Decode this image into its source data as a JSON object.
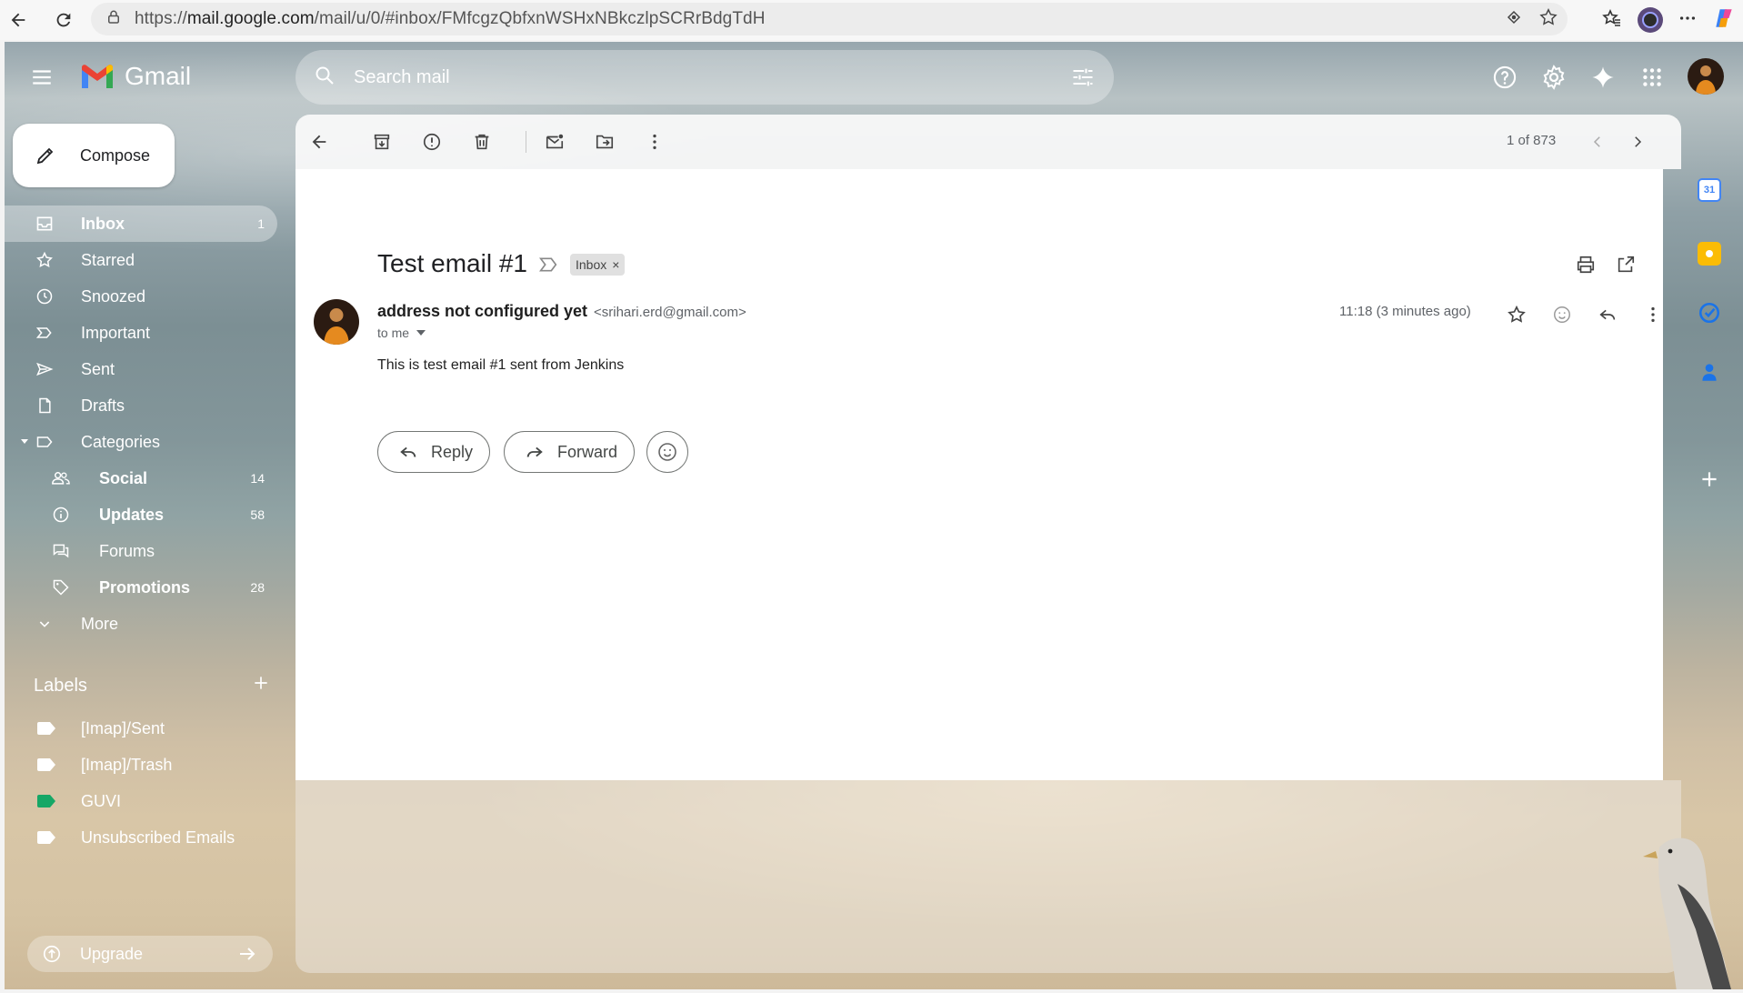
{
  "browser": {
    "url_prefix": "https://",
    "url_host": "mail.google.com",
    "url_path": "/mail/u/0/#inbox/FMfcgzQbfxnWSHxNBkczlpSCRrBdgTdH"
  },
  "app": {
    "name": "Gmail"
  },
  "search": {
    "placeholder": "Search mail"
  },
  "sidebar": {
    "compose_label": "Compose",
    "items": [
      {
        "label": "Inbox",
        "count": "1"
      },
      {
        "label": "Starred",
        "count": ""
      },
      {
        "label": "Snoozed",
        "count": ""
      },
      {
        "label": "Important",
        "count": ""
      },
      {
        "label": "Sent",
        "count": ""
      },
      {
        "label": "Drafts",
        "count": ""
      },
      {
        "label": "Categories",
        "count": ""
      }
    ],
    "categories": [
      {
        "label": "Social",
        "count": "14"
      },
      {
        "label": "Updates",
        "count": "58"
      },
      {
        "label": "Forums",
        "count": ""
      },
      {
        "label": "Promotions",
        "count": "28"
      }
    ],
    "more_label": "More",
    "labels_heading": "Labels",
    "labels": [
      {
        "label": "[Imap]/Sent",
        "color": "#ffffff"
      },
      {
        "label": "[Imap]/Trash",
        "color": "#ffffff"
      },
      {
        "label": "GUVI",
        "color": "#16a766"
      },
      {
        "label": "Unsubscribed Emails",
        "color": "#ffffff"
      }
    ],
    "upgrade_label": "Upgrade"
  },
  "toolbar": {
    "pager": "1 of 873"
  },
  "message": {
    "subject": "Test email #1",
    "label_chip": "Inbox",
    "label_chip_close": "×",
    "sender_name": "address not configured yet",
    "sender_email": "<srihari.erd@gmail.com>",
    "recipient": "to me",
    "time": "11:18 (3 minutes ago)",
    "body": "This is test email #1 sent from Jenkins",
    "reply_label": "Reply",
    "forward_label": "Forward"
  },
  "side_panel": {
    "calendar_day": "31"
  },
  "colors": {
    "gmail_red": "#ea4335",
    "gmail_blue": "#4285f4",
    "gmail_green": "#34a853",
    "gmail_yellow": "#fbbc04",
    "label_guvi": "#16a766"
  }
}
